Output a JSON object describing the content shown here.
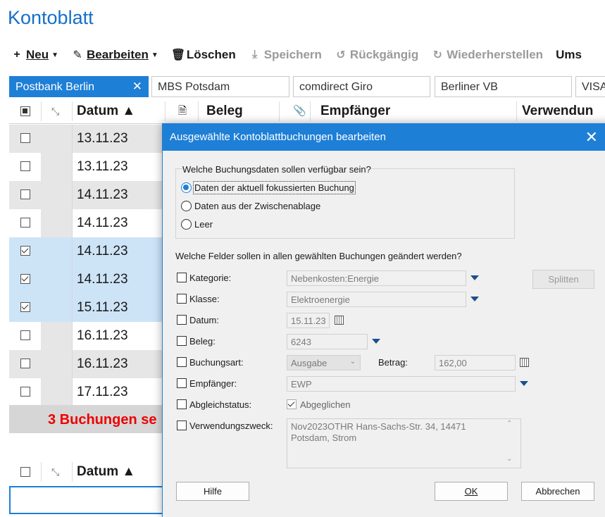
{
  "app": {
    "title": "Kontoblatt"
  },
  "toolbar": {
    "neu": "Neu",
    "bearbeiten": "Bearbeiten",
    "loeschen": "Löschen",
    "speichern": "Speichern",
    "rueckgaengig": "Rückgängig",
    "wiederherstellen": "Wiederherstellen",
    "ums": "Ums"
  },
  "tabs": [
    {
      "label": "Postbank Berlin"
    },
    {
      "label": "MBS Potsdam"
    },
    {
      "label": "comdirect Giro"
    },
    {
      "label": "Berliner VB"
    },
    {
      "label": "VISA"
    }
  ],
  "table": {
    "columns": {
      "datum": "Datum ▲",
      "beleg": "Beleg",
      "empfaenger": "Empfänger",
      "verwendung": "Verwendun"
    },
    "rows": [
      {
        "date": "13.11.23",
        "checked": false
      },
      {
        "date": "13.11.23",
        "checked": false
      },
      {
        "date": "14.11.23",
        "checked": false
      },
      {
        "date": "14.11.23",
        "checked": false
      },
      {
        "date": "14.11.23",
        "checked": true
      },
      {
        "date": "14.11.23",
        "checked": true
      },
      {
        "date": "15.11.23",
        "checked": true
      },
      {
        "date": "16.11.23",
        "checked": false
      },
      {
        "date": "16.11.23",
        "checked": false
      },
      {
        "date": "17.11.23",
        "checked": false
      }
    ],
    "summary": "3 Buchungen se",
    "lower_header": {
      "datum": "Datum ▲"
    }
  },
  "dialog": {
    "title": "Ausgewählte Kontoblattbuchungen bearbeiten",
    "group_label": "Welche Buchungsdaten sollen verfügbar sein?",
    "options": [
      "Daten der aktuell fokussierten Buchung",
      "Daten aus der Zwischenablage",
      "Leer"
    ],
    "selected_option": 0,
    "fields_question": "Welche Felder sollen in allen gewählten Buchungen geändert werden?",
    "fields": {
      "kategorie": {
        "label": "Kategorie:",
        "value": "Nebenkosten:Energie"
      },
      "klasse": {
        "label": "Klasse:",
        "value": "Elektroenergie"
      },
      "datum": {
        "label": "Datum:",
        "value": "15.11.23"
      },
      "beleg": {
        "label": "Beleg:",
        "value": "6243"
      },
      "buchungsart": {
        "label": "Buchungsart:",
        "value": "Ausgabe"
      },
      "betrag": {
        "label": "Betrag:",
        "value": "162,00"
      },
      "empfaenger": {
        "label": "Empfänger:",
        "value": "EWP"
      },
      "abgleichstatus": {
        "label": "Abgleichstatus:",
        "value": "Abgeglichen"
      },
      "verwendungszweck": {
        "label": "Verwendungszweck:",
        "value": "Nov2023OTHR Hans-Sachs-Str. 34, 14471 Potsdam, Strom"
      }
    },
    "buttons": {
      "splitten": "Splitten",
      "hilfe": "Hilfe",
      "ok": "OK",
      "abbrechen": "Abbrechen"
    }
  },
  "colors": {
    "accent": "#1e7fd6",
    "title": "#1570c8",
    "summary_text": "#e00000",
    "selected_row": "#cde4f7",
    "alt_row": "#e6e6e6"
  }
}
